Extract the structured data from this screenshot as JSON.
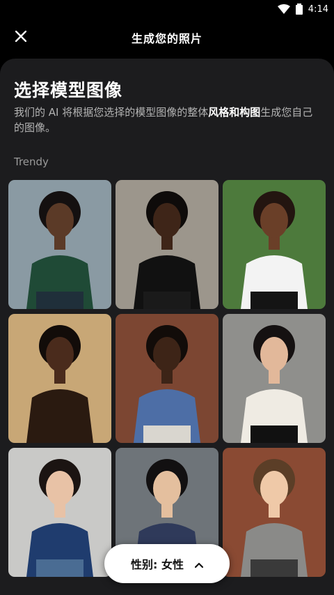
{
  "status": {
    "time": "4:14"
  },
  "header": {
    "title": "生成您的照片",
    "close_icon": "close-icon"
  },
  "sheet": {
    "title": "选择模型图像",
    "desc_before": "我们的 AI 将根据您选择的模型图像的整体",
    "desc_bold": "风格和构图",
    "desc_after": "生成您自己的图像。",
    "section": "Trendy"
  },
  "tiles": [
    {
      "bg": "#8a9aa3",
      "skin": "#5b3a27",
      "hair": "#141010",
      "top": "#1f4a36",
      "bottom": "#1f2f3a"
    },
    {
      "bg": "#9c968c",
      "skin": "#3e2518",
      "hair": "#0e0b0a",
      "top": "#111111",
      "bottom": "#1a1a1a"
    },
    {
      "bg": "#4d7a3c",
      "skin": "#6a3f28",
      "hair": "#231510",
      "top": "#f3f3f3",
      "bottom": "#141414"
    },
    {
      "bg": "#c8a776",
      "skin": "#4a2b1c",
      "hair": "#120c09",
      "top": "#2a1a10",
      "bottom": "#2a1a10"
    },
    {
      "bg": "#7c4632",
      "skin": "#3d2417",
      "hair": "#120c09",
      "top": "#4d6ea6",
      "bottom": "#d9d6cf"
    },
    {
      "bg": "#8f8f8c",
      "skin": "#e2b89a",
      "hair": "#151111",
      "top": "#efebe3",
      "bottom": "#111111"
    },
    {
      "bg": "#c9c9c7",
      "skin": "#e8c2a6",
      "hair": "#1b1412",
      "top": "#1f3c6e",
      "bottom": "#4a6c93"
    },
    {
      "bg": "#6e7479",
      "skin": "#e4bf9e",
      "hair": "#121011",
      "top": "#2f3a5a",
      "bottom": "#2f3a5a"
    },
    {
      "bg": "#8a4a33",
      "skin": "#efc9a8",
      "hair": "#5b3e27",
      "top": "#8a8a88",
      "bottom": "#3a3a3a"
    }
  ],
  "gender": {
    "label": "性别: 女性",
    "icon": "chevron-up-icon"
  }
}
